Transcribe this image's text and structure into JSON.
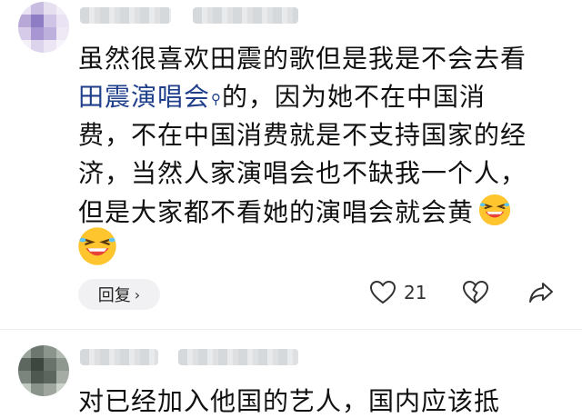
{
  "comment1": {
    "lines": [
      "虽然很喜欢田震的歌但是我是不会去看",
      "的，因为她不在中国消",
      "费，不在中国消费就是不支持国家的经",
      "济，当然人家演唱会也不缺我一个人，",
      "但是大家都不看她的演唱会就会黄"
    ],
    "link_text": "田震演唱会",
    "search_glyph": "⚲",
    "reply_label": "回复",
    "reply_chevron": "›",
    "like_count": "21"
  },
  "comment2": {
    "text": "对已经加入他国的艺人，国内应该抵"
  },
  "icons": {
    "emoji": "laughing-face-icon",
    "like": "heart-icon",
    "dislike": "broken-heart-icon",
    "share": "share-arrow-icon",
    "chevron": "chevron-right-icon"
  },
  "colors": {
    "link": "#1f3f8a",
    "text": "#111111",
    "reply_bg": "#f1f1f3",
    "emoji_face": "#ffc52e"
  }
}
